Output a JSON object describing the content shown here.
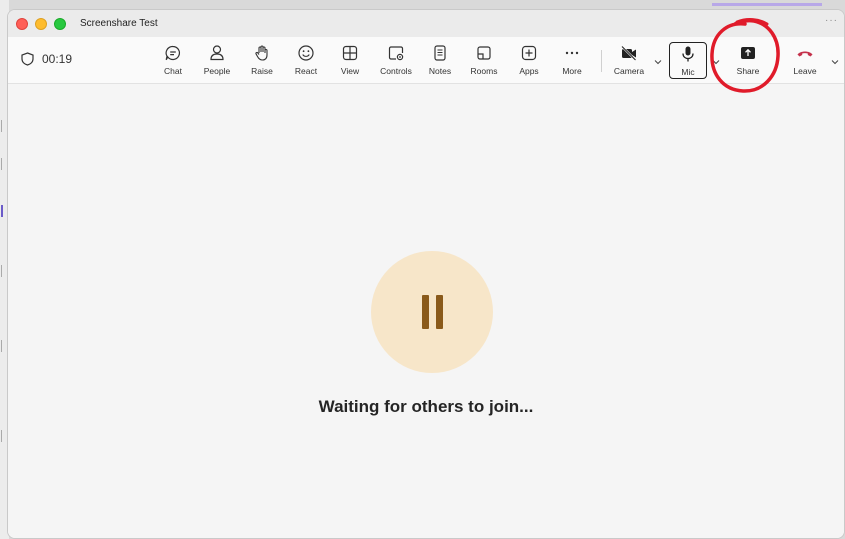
{
  "window": {
    "title": "Screenshare Test",
    "more": "···"
  },
  "call": {
    "timer": "00:19"
  },
  "toolbar": {
    "chat": "Chat",
    "people": "People",
    "raise": "Raise",
    "react": "React",
    "view": "View",
    "controls": "Controls",
    "notes": "Notes",
    "rooms": "Rooms",
    "apps": "Apps",
    "more": "More",
    "camera": "Camera",
    "mic": "Mic",
    "share": "Share",
    "leave": "Leave"
  },
  "main": {
    "status": "Waiting for others to join..."
  },
  "colors": {
    "leave": "#c4314b",
    "avatar_bg": "#f7e6c9",
    "pause": "#8a5a1a",
    "annotation": "#e01b2a"
  },
  "icons": [
    "shield-icon",
    "chat-icon",
    "people-icon",
    "raise-hand-icon",
    "react-icon",
    "view-icon",
    "controls-icon",
    "notes-icon",
    "rooms-icon",
    "apps-icon",
    "more-icon",
    "camera-off-icon",
    "mic-icon",
    "share-icon",
    "phone-hangup-icon",
    "chevron-down-icon",
    "pause-icon"
  ]
}
